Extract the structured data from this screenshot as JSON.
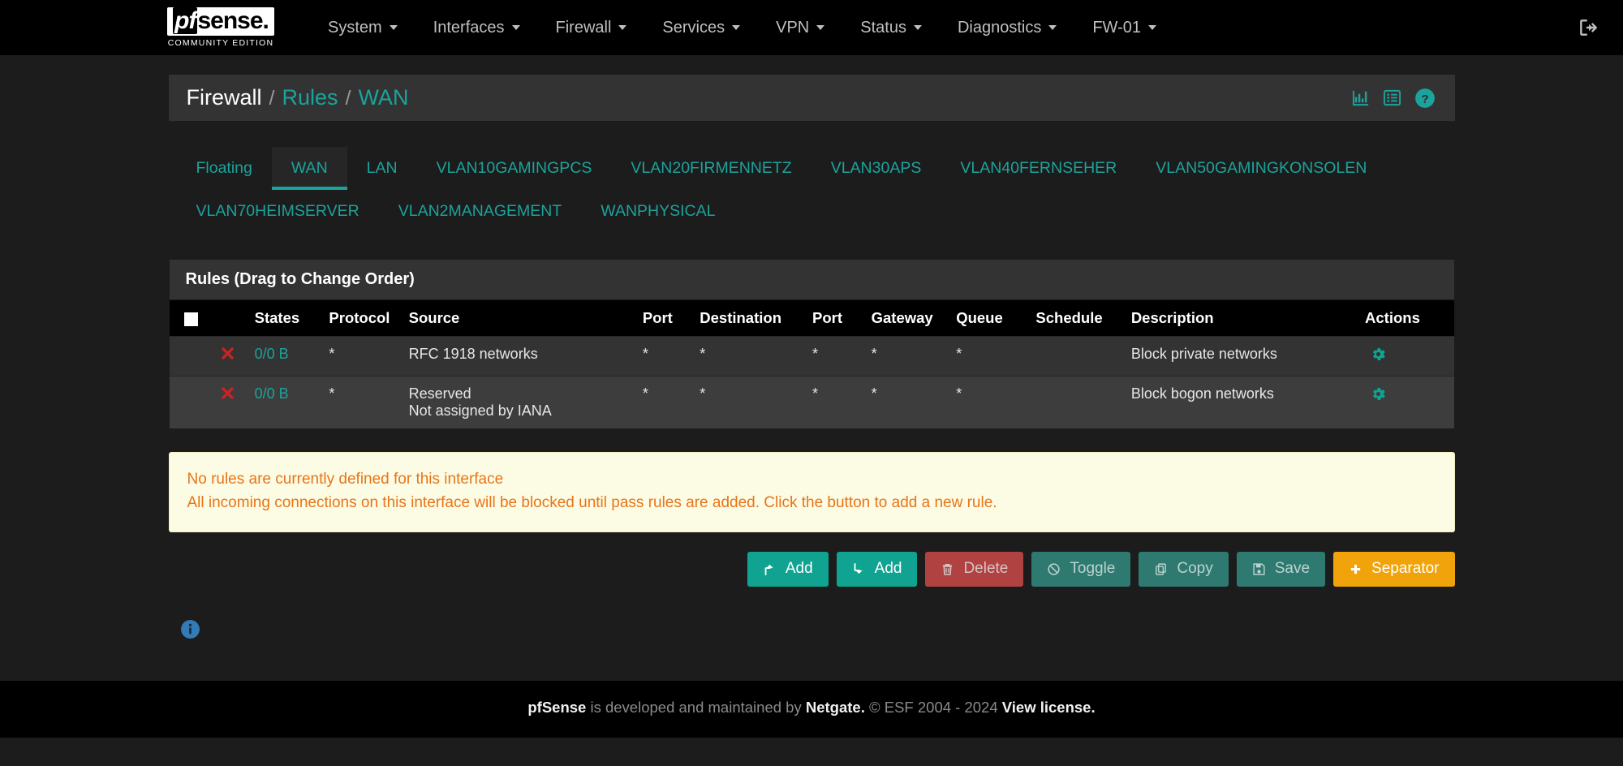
{
  "navbar": {
    "brand": {
      "logo_pf": "pf",
      "logo_sense": "sense.",
      "subtitle": "COMMUNITY EDITION"
    },
    "items": [
      {
        "label": "System"
      },
      {
        "label": "Interfaces"
      },
      {
        "label": "Firewall"
      },
      {
        "label": "Services"
      },
      {
        "label": "VPN"
      },
      {
        "label": "Status"
      },
      {
        "label": "Diagnostics"
      },
      {
        "label": "FW-01"
      }
    ],
    "logout_title": "Logout"
  },
  "header": {
    "breadcrumb": [
      {
        "label": "Firewall",
        "link": false
      },
      {
        "label": "Rules",
        "link": true
      },
      {
        "label": "WAN",
        "link": true
      }
    ],
    "separator": "/",
    "icons": [
      {
        "name": "chart-icon",
        "title": "Traffic Graph"
      },
      {
        "name": "list-icon",
        "title": "Rule Listing"
      },
      {
        "name": "help-icon",
        "title": "Help"
      }
    ]
  },
  "tabs": [
    {
      "label": "Floating",
      "active": false
    },
    {
      "label": "WAN",
      "active": true
    },
    {
      "label": "LAN",
      "active": false
    },
    {
      "label": "VLAN10GAMINGPCS",
      "active": false
    },
    {
      "label": "VLAN20FIRMENNETZ",
      "active": false
    },
    {
      "label": "VLAN30APS",
      "active": false
    },
    {
      "label": "VLAN40FERNSEHER",
      "active": false
    },
    {
      "label": "VLAN50GAMINGKONSOLEN",
      "active": false
    },
    {
      "label": "VLAN70HEIMSERVER",
      "active": false
    },
    {
      "label": "VLAN2MANAGEMENT",
      "active": false
    },
    {
      "label": "WANPHYSICAL",
      "active": false
    }
  ],
  "panel": {
    "title": "Rules (Drag to Change Order)",
    "columns": [
      "",
      "",
      "States",
      "Protocol",
      "Source",
      "Port",
      "Destination",
      "Port",
      "Gateway",
      "Queue",
      "Schedule",
      "Description",
      "Actions"
    ],
    "rows": [
      {
        "action_icon": "block-icon",
        "states": "0/0 B",
        "protocol": "*",
        "source": "RFC 1918 networks",
        "source_line2": "",
        "port": "*",
        "destination": "*",
        "dest_port": "*",
        "gateway": "*",
        "queue": "*",
        "schedule": "",
        "description": "Block private networks",
        "action": "gear-icon"
      },
      {
        "action_icon": "block-icon",
        "states": "0/0 B",
        "protocol": "*",
        "source": "Reserved",
        "source_line2": "Not assigned by IANA",
        "port": "*",
        "destination": "*",
        "dest_port": "*",
        "gateway": "*",
        "queue": "*",
        "schedule": "",
        "description": "Block bogon networks",
        "action": "gear-icon"
      }
    ]
  },
  "alert": {
    "line1": "No rules are currently defined for this interface",
    "line2": "All incoming connections on this interface will be blocked until pass rules are added. Click the button to add a new rule."
  },
  "buttons": [
    {
      "label": "Add",
      "icon": "arrow-up-icon",
      "style": "btn-success"
    },
    {
      "label": "Add",
      "icon": "arrow-down-icon",
      "style": "btn-success"
    },
    {
      "label": "Delete",
      "icon": "trash-icon",
      "style": "btn-danger"
    },
    {
      "label": "Toggle",
      "icon": "ban-icon",
      "style": "btn-muted"
    },
    {
      "label": "Copy",
      "icon": "copy-icon",
      "style": "btn-muted"
    },
    {
      "label": "Save",
      "icon": "save-icon",
      "style": "btn-muted"
    },
    {
      "label": "Separator",
      "icon": "plus-icon",
      "style": "btn-warning"
    }
  ],
  "info": {
    "icon": "info-icon"
  },
  "footer": {
    "product": "pfSense",
    "text1": " is developed and maintained by ",
    "company": "Netgate.",
    "text2": " © ESF 2004 - 2024 ",
    "license_link": "View license."
  },
  "colors": {
    "accent_teal": "#1ba39c",
    "block_red": "#cc2222",
    "warning_orange": "#e8751a",
    "separator_orange": "#f0a30a",
    "info_blue": "#337ab7"
  }
}
